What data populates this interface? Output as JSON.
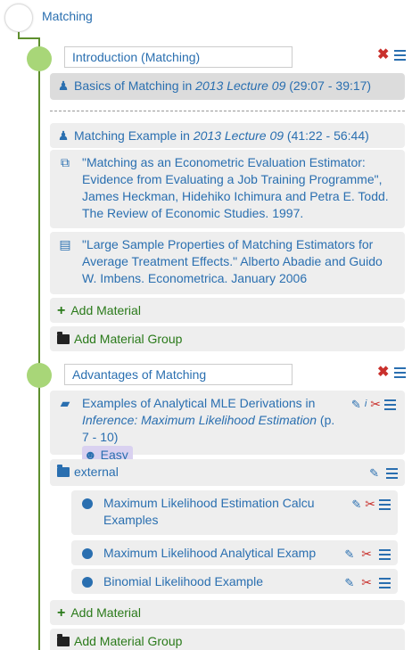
{
  "root": {
    "title": "Matching"
  },
  "sections": [
    {
      "title": "Introduction (Matching)",
      "items": [
        {
          "kind": "lecture",
          "text": "Basics of Matching in ",
          "italic": "2013 Lecture 09",
          "suffix": " (29:07 - 39:17)"
        },
        {
          "kind": "lecture",
          "text": "Matching Example in ",
          "italic": "2013 Lecture 09",
          "suffix": " (41:22 - 56:44)"
        },
        {
          "kind": "external-link",
          "text": "\"Matching as an Econometric Evaluation Estimator: Evidence from Evaluating a Job Training Programme\", James Heckman, Hidehiko Ichimura and Petra E. Todd. The Review of Economic Studies. 1997."
        },
        {
          "kind": "pdf",
          "text": "\"Large Sample Properties of Matching Estimators for Average Treatment Effects.\" Alberto Abadie and Guido W. Imbens. Econometrica. January 2006"
        }
      ],
      "add_material": "Add Material",
      "add_group": "Add Material Group"
    },
    {
      "title": "Advantages of Matching",
      "items": [
        {
          "kind": "book",
          "text": "Examples of Analytical MLE Derivations in ",
          "italic": "Inference: Maximum Likelihood Estimation",
          "suffix": " (p. 7 - 10)",
          "badge": "Easy"
        }
      ],
      "group": {
        "name": "external",
        "items": [
          {
            "text": "Maximum Likelihood Estimation Calcu",
            "text2": "Examples"
          },
          {
            "text": "Maximum Likelihood Analytical Examp"
          },
          {
            "text": "Binomial Likelihood Example"
          }
        ]
      },
      "add_material": "Add Material",
      "add_group": "Add Material Group"
    }
  ],
  "colors": {
    "link": "#2a6fb0",
    "node": "#a8d678",
    "tree_line": "#5e8f2e",
    "delete": "#c9302c",
    "add": "#2a7a1a"
  },
  "icons": [
    "lecture-icon",
    "external-link-icon",
    "pdf-icon",
    "book-icon",
    "folder-icon",
    "globe-icon",
    "pencil-icon",
    "scissors-icon",
    "delete-icon",
    "menu-icon",
    "plus-icon"
  ]
}
